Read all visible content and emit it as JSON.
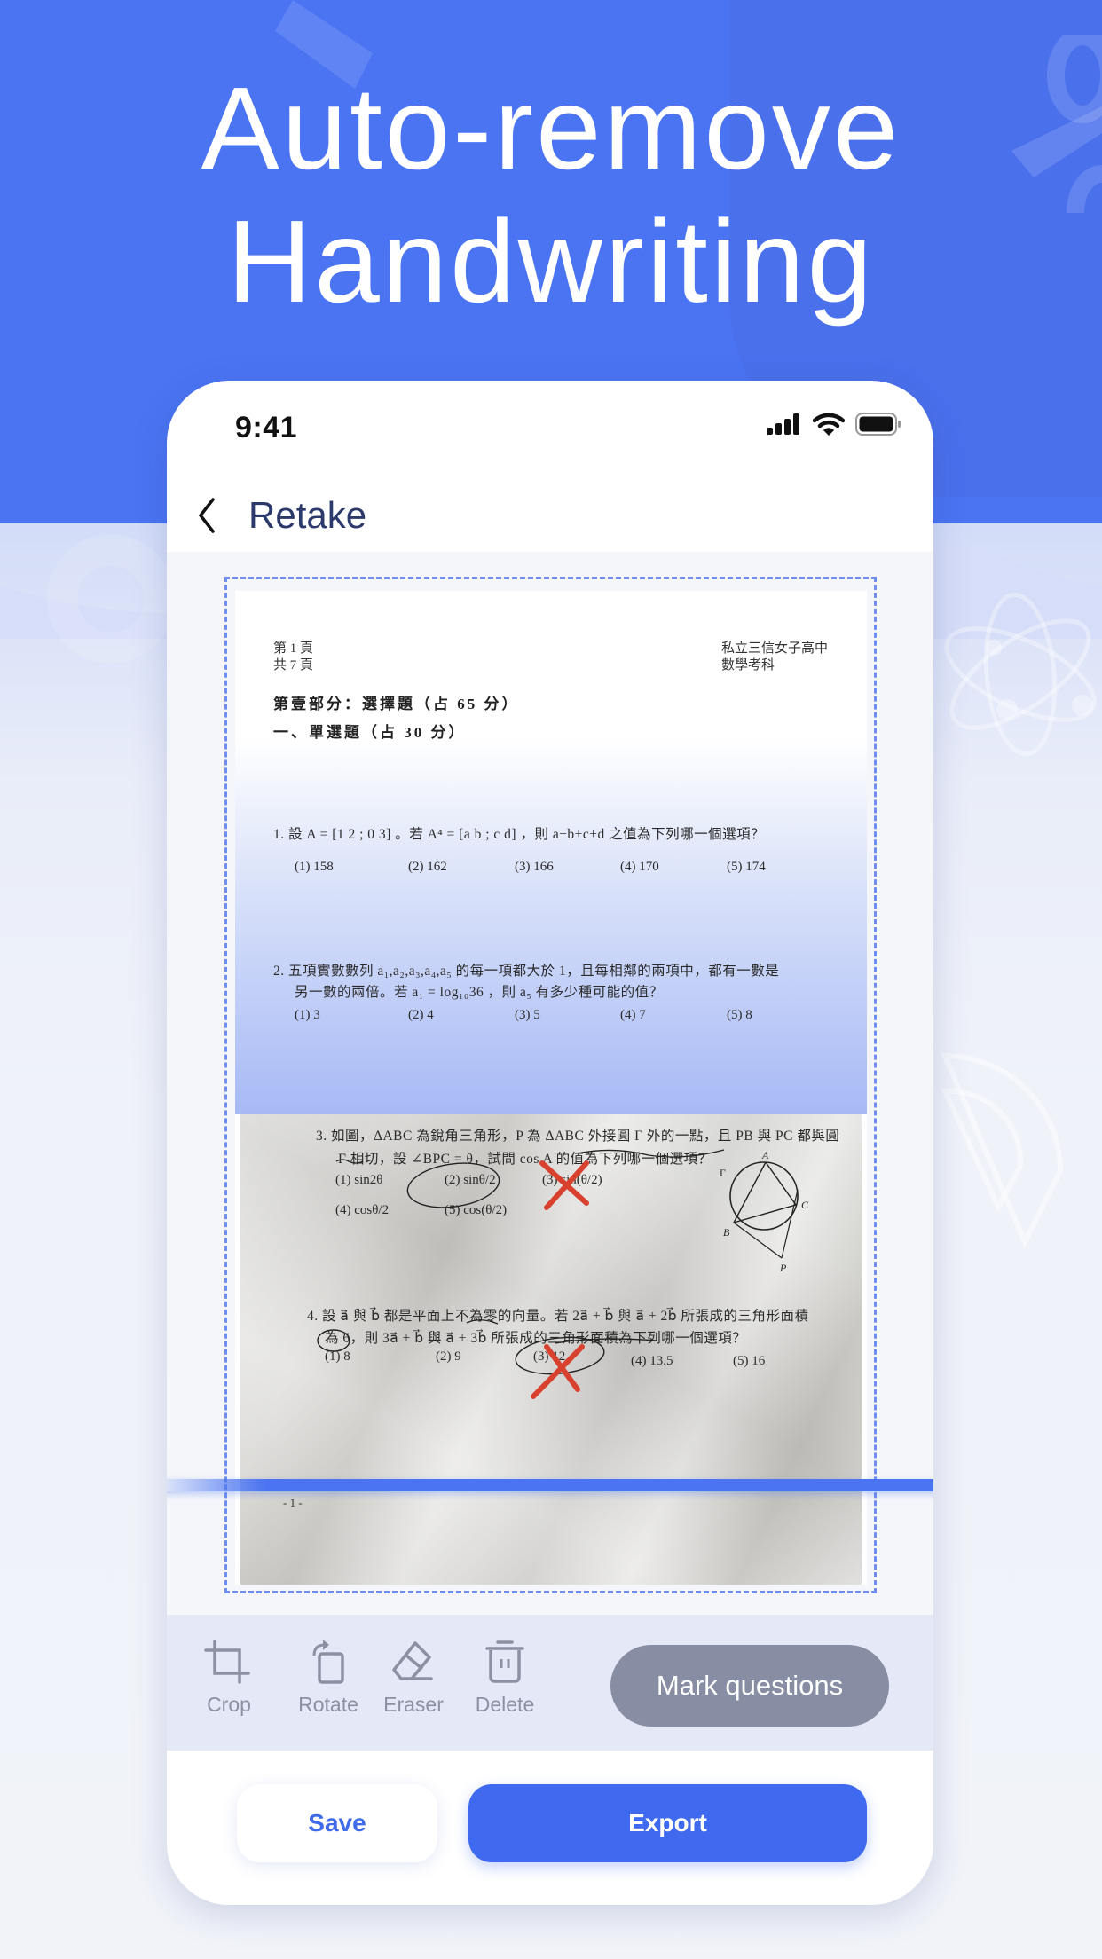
{
  "hero": {
    "line1": "Auto-remove",
    "line2": "Handwriting"
  },
  "status_bar": {
    "time": "9:41",
    "icons": [
      "cellular-signal-icon",
      "wifi-icon",
      "battery-icon"
    ]
  },
  "nav": {
    "back_icon": "chevron-left-icon",
    "retake_label": "Retake"
  },
  "document": {
    "header_left": [
      "第 1 頁",
      "共 7 頁"
    ],
    "header_right": [
      "私立三信女子高中",
      "數學考科"
    ],
    "section_title": "第壹部分：選擇題（占 65 分）",
    "subsection_title": "一、單選題（占 30 分）",
    "questions": [
      {
        "number": "1.",
        "text": "設 A=[1 2; 0 3]。若 A⁴=[a b; c d]，則 a+b+c+d 之值為下列哪一個選項？",
        "lines": [
          "1.  設 A = [1 2 ; 0 3] 。若 A⁴ = [a b ; c d] ，則 a+b+c+d 之值為下列哪一個選項？"
        ],
        "options": [
          "(1) 158",
          "(2) 162",
          "(3) 166",
          "(4) 170",
          "(5) 174"
        ]
      },
      {
        "number": "2.",
        "lines": [
          "2.  五項實數數列 a₁,a₂,a₃,a₄,a₅ 的每一項都大於 1，且每相鄰的兩項中，都有一數是",
          "另一數的兩倍。若 a₁ = log₁₀36 ，則 a₅ 有多少種可能的值？"
        ],
        "options": [
          "(1) 3",
          "(2) 4",
          "(3) 5",
          "(4) 7",
          "(5) 8"
        ]
      },
      {
        "number": "3.",
        "lines": [
          "3.  如圖，ΔABC 為銳角三角形，P 為 ΔABC 外接圓 Γ 外的一點，且 PB 與 PC 都與圓",
          "Γ 相切，設 ∠BPC = θ，試問 cos A 的值為下列哪一個選項？"
        ],
        "options": [
          "(1) sin2θ",
          "(2) sinθ/2",
          "(3) sin(θ/2)",
          "(4) cosθ/2",
          "(5) cos(θ/2)"
        ],
        "diagram_labels": [
          "A",
          "B",
          "C",
          "P",
          "Γ"
        ]
      },
      {
        "number": "4.",
        "lines": [
          "4.  設 a⃗ 與 b⃗ 都是平面上不為零的向量。若 2a⃗ + b⃗ 與 a⃗ + 2b⃗ 所張成的三角形面積",
          "為 6，則 3a⃗ + b⃗ 與 a⃗ + 3b⃗ 所張成的三角形面積為下列哪一個選項？"
        ],
        "options": [
          "(1) 8",
          "(2) 9",
          "(3) 12",
          "(4) 13.5",
          "(5) 16"
        ]
      }
    ],
    "page_number": "- 1 -"
  },
  "toolbar": {
    "tools": [
      {
        "label": "Crop",
        "icon": "crop-icon"
      },
      {
        "label": "Rotate",
        "icon": "rotate-icon"
      },
      {
        "label": "Eraser",
        "icon": "eraser-icon"
      },
      {
        "label": "Delete",
        "icon": "trash-icon"
      }
    ],
    "mark_questions_label": "Mark questions"
  },
  "actions": {
    "save_label": "Save",
    "export_label": "Export"
  },
  "colors": {
    "brand_blue": "#4a74f2",
    "primary_button": "#3f6aef",
    "mark_button": "#878ea3",
    "annotation_red": "#d9412f"
  }
}
